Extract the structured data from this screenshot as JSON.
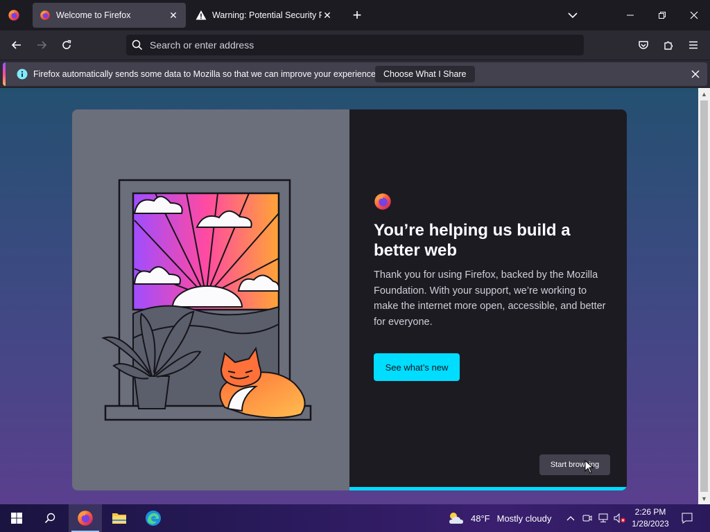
{
  "browser": {
    "tabs": [
      {
        "label": "Welcome to Firefox",
        "active": true
      },
      {
        "label": "Warning: Potential Security Risk",
        "active": false
      }
    ],
    "address_placeholder": "Search or enter address"
  },
  "notification": {
    "message": "Firefox automatically sends some data to Mozilla so that we can improve your experience.",
    "button_label": "Choose What I Share"
  },
  "welcome": {
    "headline": "You’re helping us build a better web",
    "body": "Thank you for using Firefox, backed by the Mozilla Foundation. With your support, we’re working to make the internet more open, accessible, and better for everyone.",
    "cta_label": "See what’s new",
    "start_label": "Start browsing"
  },
  "taskbar": {
    "temperature": "48°F",
    "condition": "Mostly cloudy",
    "time": "2:26 PM",
    "date": "1/28/2023"
  },
  "colors": {
    "accent": "#00ddff",
    "chrome_dark": "#1c1b22",
    "chrome_mid": "#2b2a33",
    "tab_active": "#42414d"
  }
}
